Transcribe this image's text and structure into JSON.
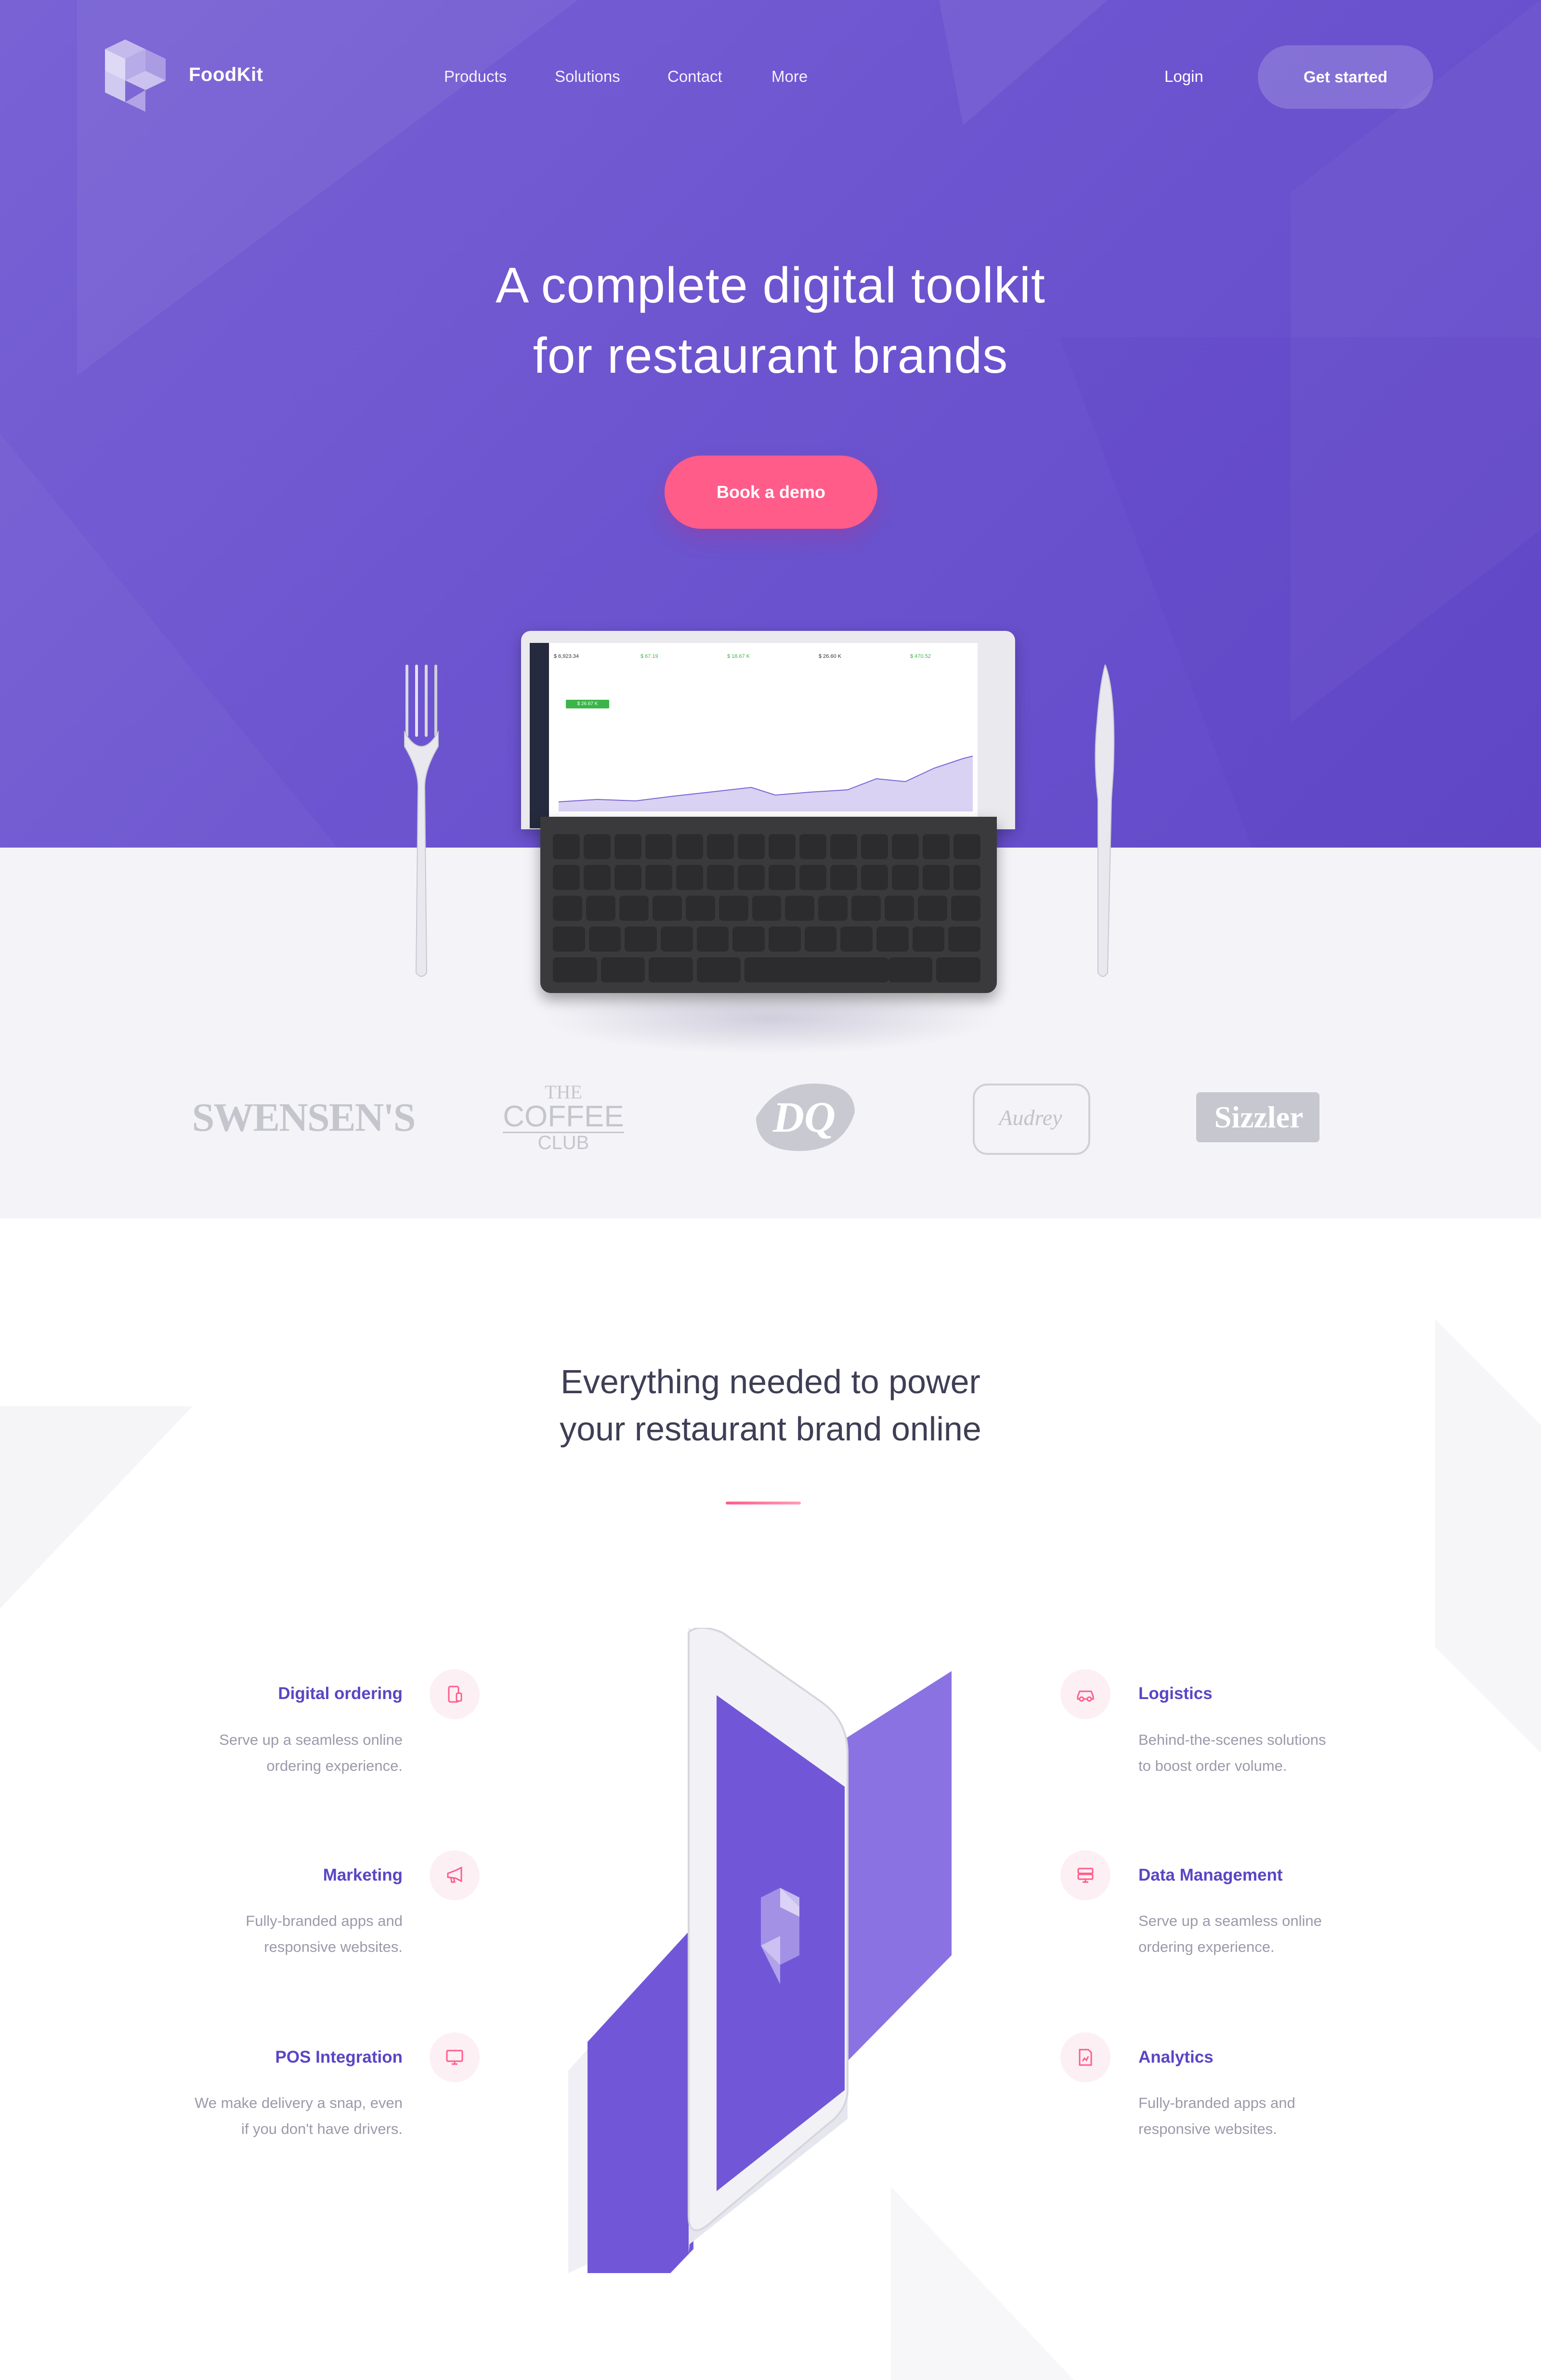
{
  "colors": {
    "hero": "#6d55d0",
    "accent": "#ff5c8a",
    "title_purple": "#5b45c4"
  },
  "nav": {
    "brand": "FoodKit",
    "links": [
      "Products",
      "Solutions",
      "Contact",
      "More"
    ],
    "login": "Login",
    "cta": "Get started"
  },
  "hero": {
    "title_line1": "A complete digital toolkit",
    "title_line2": "for restaurant brands",
    "cta": "Book a demo"
  },
  "clients": [
    "SWENSEN'S",
    "THE",
    "COFFEE",
    "CLUB",
    "DQ",
    "Audrey",
    "Sizzler"
  ],
  "section": {
    "title_line1": "Everything needed to power",
    "title_line2": "your restaurant brand online"
  },
  "features_left": [
    {
      "title": "Digital ordering",
      "desc1": "Serve up a seamless online",
      "desc2": "ordering experience.",
      "icon": "tablet-icon"
    },
    {
      "title": "Marketing",
      "desc1": "Fully-branded apps and",
      "desc2": "responsive websites.",
      "icon": "megaphone-icon"
    },
    {
      "title": "POS Integration",
      "desc1": "We make delivery a snap, even",
      "desc2": "if you don't have drivers.",
      "icon": "monitor-icon"
    }
  ],
  "features_right": [
    {
      "title": "Logistics",
      "desc1": "Behind-the-scenes solutions",
      "desc2": "to boost order volume.",
      "icon": "car-icon"
    },
    {
      "title": "Data Management",
      "desc1": "Serve up a seamless online",
      "desc2": "ordering experience.",
      "icon": "server-icon"
    },
    {
      "title": "Analytics",
      "desc1": "Fully-branded apps and",
      "desc2": "responsive websites.",
      "icon": "report-icon"
    }
  ],
  "dashboard": {
    "stats": [
      "$ 6,923.34",
      "$ 67.19",
      "$ 18.67 K",
      "$ 26.60 K",
      "$ 470.52"
    ],
    "highlight": "$ 26.67 K"
  }
}
